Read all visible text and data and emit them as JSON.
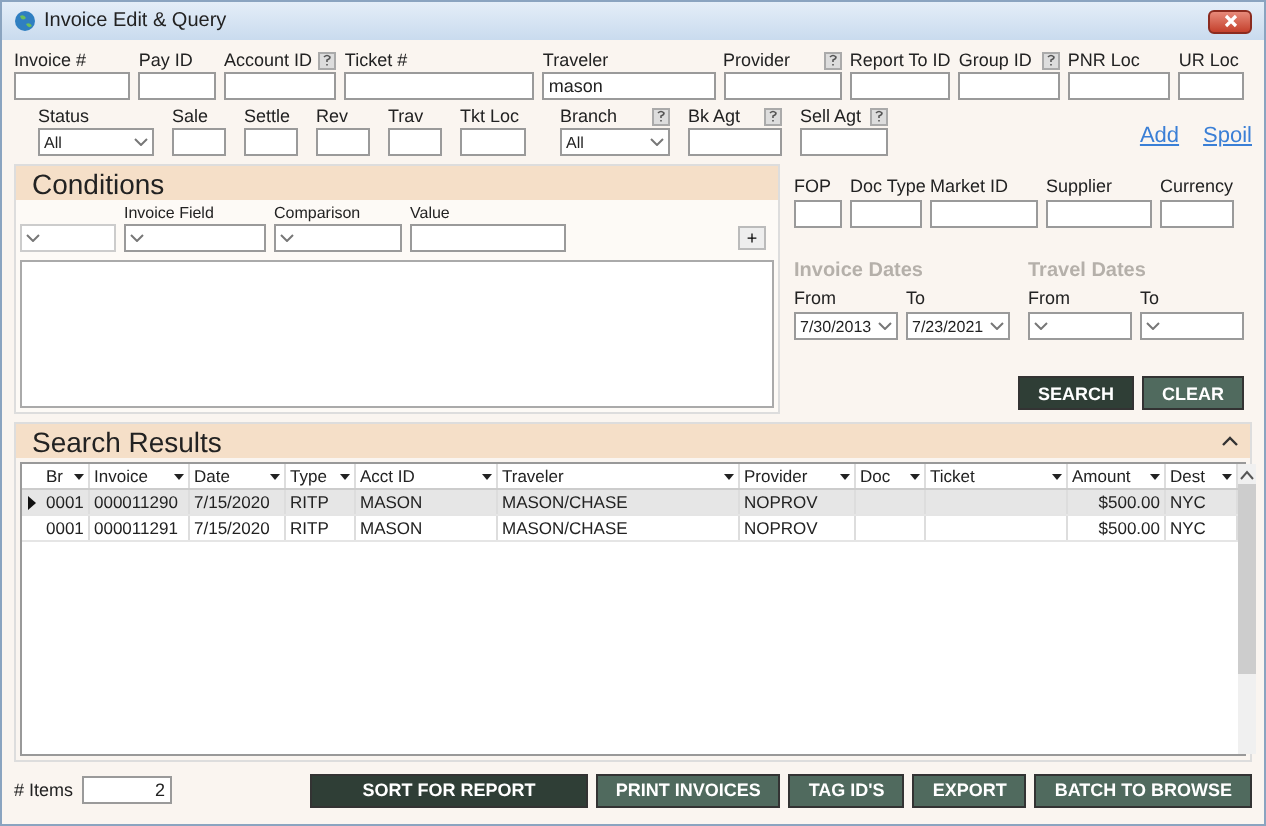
{
  "window": {
    "title": "Invoice Edit & Query"
  },
  "filters_row_1": [
    {
      "label": "Invoice #",
      "help": false
    },
    {
      "label": "Pay ID",
      "help": false
    },
    {
      "label": "Account ID",
      "help": true
    },
    {
      "label": "Ticket #",
      "help": false
    },
    {
      "label": "Traveler",
      "help": false,
      "value": "mason"
    },
    {
      "label": "Provider",
      "help": true
    },
    {
      "label": "Report To ID",
      "help": false
    },
    {
      "label": "Group ID",
      "help": true
    },
    {
      "label": "PNR Loc",
      "help": false
    },
    {
      "label": "UR Loc",
      "help": false
    }
  ],
  "filters_row_2": [
    {
      "label": "Status",
      "kind": "select",
      "help": false,
      "value": "All"
    },
    {
      "label": "Sale",
      "kind": "text",
      "help": false
    },
    {
      "label": "Settle",
      "kind": "text",
      "help": false
    },
    {
      "label": "Rev",
      "kind": "text",
      "help": false
    },
    {
      "label": "Trav",
      "kind": "text",
      "help": false
    },
    {
      "label": "Tkt Loc",
      "kind": "text",
      "help": false
    },
    {
      "label": "Branch",
      "kind": "select",
      "help": true,
      "value": "All"
    },
    {
      "label": "Bk Agt",
      "kind": "text",
      "help": true
    },
    {
      "label": "Sell Agt",
      "kind": "text",
      "help": true
    }
  ],
  "links": [
    "Add",
    "Spoil"
  ],
  "conditions": {
    "title": "Conditions",
    "columns": [
      "Invoice Field",
      "Comparison",
      "Value"
    ],
    "add_button": "+"
  },
  "details": {
    "fields": [
      "FOP",
      "Doc Type",
      "Market ID",
      "Supplier",
      "Currency"
    ],
    "date_groups": [
      {
        "title": "Invoice Dates",
        "from_label": "From",
        "from_value": "7/30/2013",
        "to_label": "To",
        "to_value": "7/23/2021"
      },
      {
        "title": "Travel Dates",
        "from_label": "From",
        "to_label": "To"
      }
    ],
    "buttons": [
      "SEARCH",
      "CLEAR"
    ]
  },
  "results": {
    "title": "Search Results",
    "columns": [
      "Br",
      "Invoice",
      "Date",
      "Type",
      "Acct ID",
      "Traveler",
      "Provider",
      "Doc",
      "Ticket",
      "Amount",
      "Dest"
    ],
    "rows": [
      {
        "selected": true,
        "cells": [
          "0001",
          "000011290",
          "7/15/2020",
          "RITP",
          "MASON",
          "MASON/CHASE",
          "NOPROV",
          "",
          "",
          "$500.00",
          "NYC"
        ]
      },
      {
        "selected": false,
        "cells": [
          "0001",
          "000011291",
          "7/15/2020",
          "RITP",
          "MASON",
          "MASON/CHASE",
          "NOPROV",
          "",
          "",
          "$500.00",
          "NYC"
        ]
      }
    ]
  },
  "footer": {
    "items_label": "# Items",
    "items_value": "2",
    "buttons": [
      "SORT FOR REPORT",
      "PRINT INVOICES",
      "TAG ID'S",
      "EXPORT",
      "BATCH TO BROWSE"
    ]
  }
}
